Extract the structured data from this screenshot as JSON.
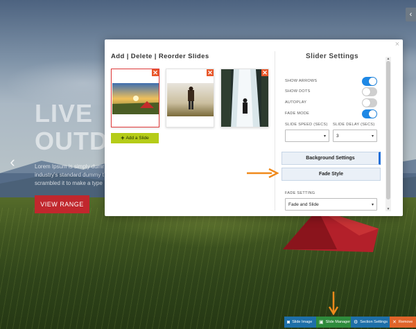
{
  "hero": {
    "title_line1": "LIVE",
    "title_line2": "OUTD",
    "desc_line1": "Lorem Ipsum is simply dumm",
    "desc_line2": "industry's standard dummy t",
    "desc_line3": "scrambled it to make a type",
    "cta_label": "VIEW RANGE",
    "prev_glyph": "‹",
    "top_right_glyph": "‹"
  },
  "modal": {
    "close_glyph": "×",
    "slides_panel": {
      "title": "Add | Delete | Reorder Slides",
      "remove_glyph": "✕",
      "add_button_label": "Add a Slide",
      "add_button_icon": "+"
    },
    "settings_panel": {
      "title": "Slider Settings",
      "toggles": [
        {
          "label": "SHOW ARROWS",
          "on": true
        },
        {
          "label": "SHOW DOTS",
          "on": false
        },
        {
          "label": "AUTOPLAY",
          "on": false
        },
        {
          "label": "FADE MODE",
          "on": true
        }
      ],
      "slide_speed": {
        "label": "SLIDE SPEED (SECS)",
        "value": ""
      },
      "slide_delay": {
        "label": "SLIDE DELAY (SECS)",
        "value": "3"
      },
      "buttons": {
        "background_settings": "Background Settings",
        "fade_style": "Fade Style"
      },
      "fade_setting": {
        "label": "FADE SETTING",
        "value": "Fade and Slide"
      },
      "caret": "▾"
    }
  },
  "toolbar": {
    "slide_image": "Slide Image",
    "slide_manager": "Slide Manager",
    "section_settings": "Section Settings",
    "remove": "Remove"
  },
  "icons": {
    "camera": "camera-icon",
    "image": "image-icon",
    "gear": "gear-icon",
    "close": "close-icon"
  },
  "colors": {
    "accent_blue": "#1e88e5",
    "add_green": "#b5cc18",
    "remove_orange": "#e8572a",
    "cta_red": "#c1272d",
    "arrow_orange": "#f08a1c"
  }
}
